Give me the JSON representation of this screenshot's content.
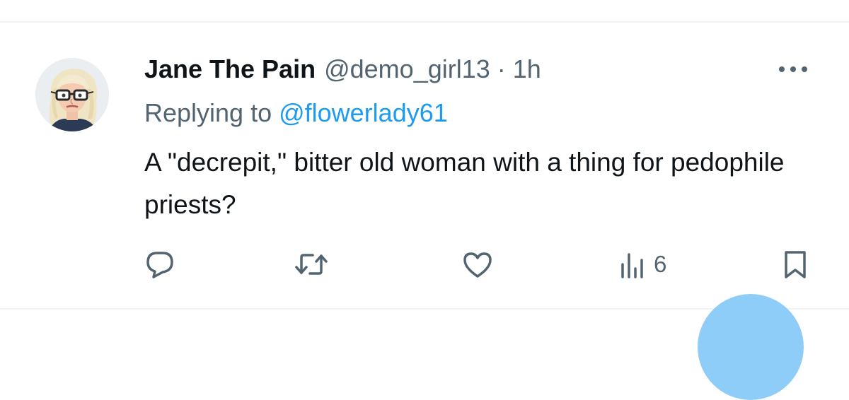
{
  "tweet": {
    "display_name": "Jane The Pain",
    "handle": "@demo_girl13",
    "separator": "·",
    "time": "1h",
    "replying_to_label": "Replying to",
    "replying_to_handle": "@flowerlady61",
    "text": "A \"decrepit,\" bitter old woman with a thing for pedophile priests?",
    "views_count": "6"
  },
  "icons": {
    "more": "more-horizontal-icon",
    "reply": "reply-bubble-icon",
    "retweet": "retweet-icon",
    "like": "heart-icon",
    "views": "views-bar-chart-icon",
    "bookmark": "bookmark-icon"
  },
  "colors": {
    "link": "#1d9bf0",
    "secondary_text": "#536471",
    "primary_text": "#0f1419",
    "divider": "#eff3f4",
    "fab": "#8ecdf8"
  }
}
